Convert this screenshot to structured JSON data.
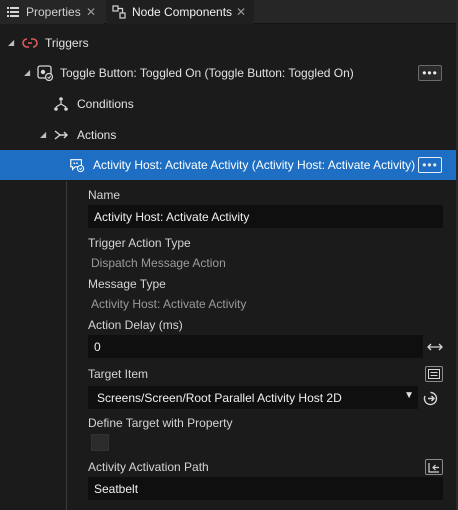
{
  "tabs": [
    {
      "label": "Properties",
      "active": false
    },
    {
      "label": "Node Components",
      "active": true
    }
  ],
  "tree": {
    "triggers_label": "Triggers",
    "toggle_label": "Toggle Button: Toggled On (Toggle Button: Toggled On)",
    "conditions_label": "Conditions",
    "actions_label": "Actions",
    "activity_label": "Activity Host: Activate Activity (Activity Host: Activate Activity)",
    "more_glyph": "•••"
  },
  "properties": {
    "name_label": "Name",
    "name_value": "Activity Host: Activate Activity",
    "trigger_action_type_label": "Trigger Action Type",
    "trigger_action_type_value": "Dispatch Message Action",
    "message_type_label": "Message Type",
    "message_type_value": "Activity Host: Activate Activity",
    "action_delay_label": "Action Delay (ms)",
    "action_delay_value": "0",
    "target_item_label": "Target Item",
    "target_item_value": "Screens/Screen/Root Parallel Activity Host 2D",
    "define_target_label": "Define Target with Property",
    "define_target_checked": false,
    "activation_path_label": "Activity Activation Path",
    "activation_path_value": "Seatbelt"
  },
  "colors": {
    "selection": "#1e6fc3",
    "trigger_icon": "#e05a5a",
    "background": "#1b1b1b"
  }
}
